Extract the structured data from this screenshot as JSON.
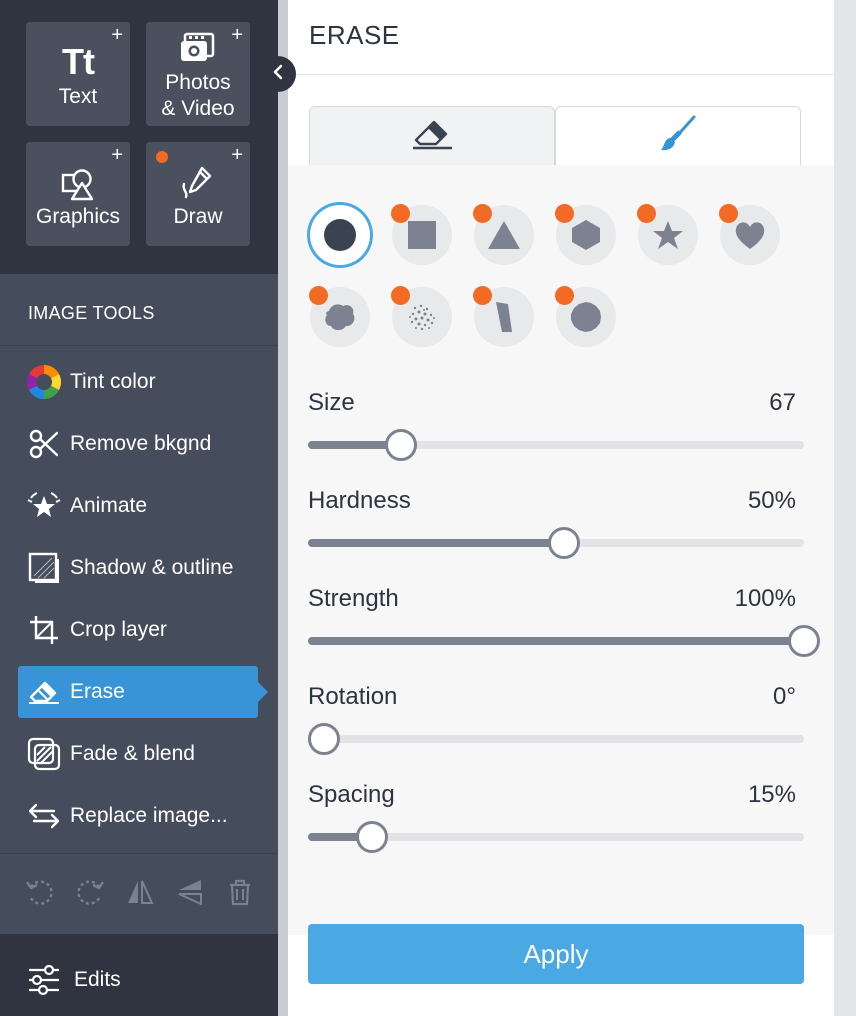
{
  "colors": {
    "sidebar_dark": "#2f3440",
    "sidebar": "#454c5b",
    "accent": "#3894d6",
    "apply": "#4aa8e2",
    "badge": "#f26a24"
  },
  "add_tiles": [
    {
      "label": "Tt",
      "text": "Text",
      "icon": "text-icon"
    },
    {
      "text": "Photos\n& Video",
      "icon": "photos-video-icon"
    },
    {
      "text": "Graphics",
      "icon": "graphics-icon"
    },
    {
      "text": "Draw",
      "icon": "draw-icon"
    }
  ],
  "tiles": {
    "text": {
      "glyph": "Tt",
      "label": "Text"
    },
    "photos": {
      "line1": "Photos",
      "line2": "& Video"
    },
    "graphics": {
      "label": "Graphics"
    },
    "draw": {
      "label": "Draw"
    },
    "plus": "+"
  },
  "image_tools": {
    "title": "IMAGE TOOLS",
    "items": [
      {
        "label": "Tint color",
        "icon": "tint-color-icon"
      },
      {
        "label": "Remove bkgnd",
        "icon": "scissors-icon"
      },
      {
        "label": "Animate",
        "icon": "animate-star-icon"
      },
      {
        "label": "Shadow & outline",
        "icon": "shadow-outline-icon"
      },
      {
        "label": "Crop layer",
        "icon": "crop-icon"
      },
      {
        "label": "Erase",
        "icon": "eraser-icon",
        "active": true
      },
      {
        "label": "Fade & blend",
        "icon": "fade-blend-icon"
      },
      {
        "label": "Replace image...",
        "icon": "replace-arrows-icon"
      }
    ]
  },
  "history_buttons": [
    "undo-icon",
    "redo-icon",
    "flip-horizontal-icon",
    "flip-vertical-icon",
    "trash-icon"
  ],
  "edits": {
    "label": "Edits",
    "icon": "sliders-icon"
  },
  "panel": {
    "title": "ERASE",
    "tabs": [
      {
        "icon": "eraser-icon",
        "active": false
      },
      {
        "icon": "paintbrush-icon",
        "active": true
      }
    ],
    "brush_shapes": [
      {
        "name": "circle",
        "selected": true,
        "badge": false
      },
      {
        "name": "square",
        "badge": true
      },
      {
        "name": "triangle",
        "badge": true
      },
      {
        "name": "hexagon",
        "badge": true
      },
      {
        "name": "star",
        "badge": true
      },
      {
        "name": "heart",
        "badge": true
      },
      {
        "name": "splat",
        "badge": true
      },
      {
        "name": "spray",
        "badge": true
      },
      {
        "name": "chisel",
        "badge": true
      },
      {
        "name": "rough-circle",
        "badge": true
      }
    ],
    "sliders": [
      {
        "label": "Size",
        "value": "67",
        "fraction": 0.16
      },
      {
        "label": "Hardness",
        "value": "50%",
        "fraction": 0.5
      },
      {
        "label": "Strength",
        "value": "100%",
        "fraction": 1.0
      },
      {
        "label": "Rotation",
        "value": "0°",
        "fraction": 0.0
      },
      {
        "label": "Spacing",
        "value": "15%",
        "fraction": 0.1
      }
    ],
    "apply_label": "Apply"
  }
}
